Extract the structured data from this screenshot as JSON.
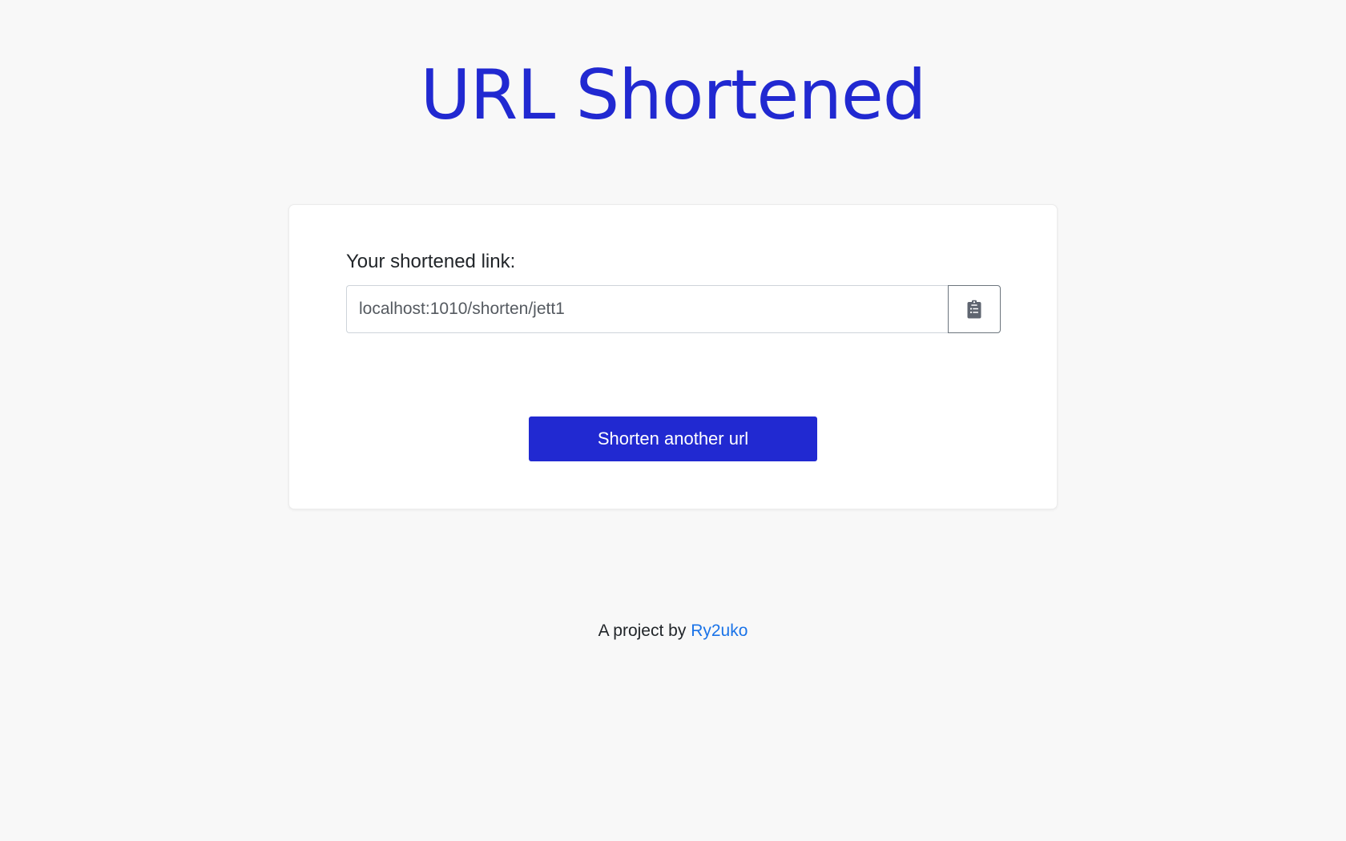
{
  "header": {
    "title": "URL Shortened"
  },
  "result": {
    "label": "Your shortened link:",
    "short_url": "localhost:1010/shorten/jett1",
    "copy_icon": "clipboard-list-icon"
  },
  "actions": {
    "shorten_another_label": "Shorten another url"
  },
  "footer": {
    "prefix": "A project by",
    "author": "Ry2uko"
  },
  "colors": {
    "brand": "#2129d1",
    "background": "#f8f8f8",
    "link": "#1a73e8"
  }
}
